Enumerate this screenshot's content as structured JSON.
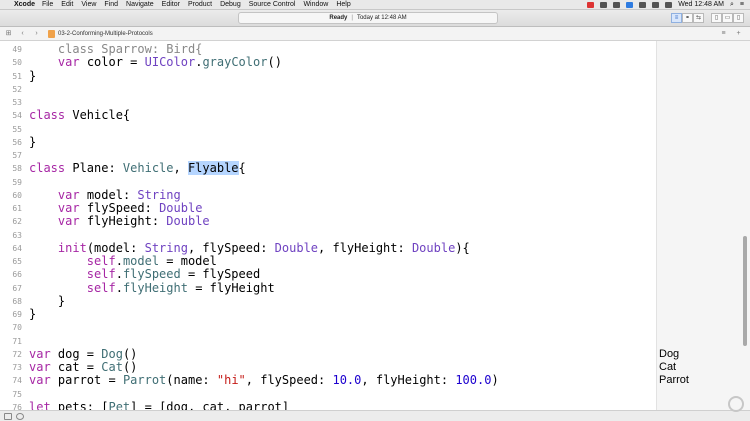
{
  "menubar": {
    "app": "Xcode",
    "items": [
      "File",
      "Edit",
      "View",
      "Find",
      "Navigate",
      "Editor",
      "Product",
      "Debug",
      "Source Control",
      "Window",
      "Help"
    ],
    "clock": "Wed 12:48 AM"
  },
  "toolbar": {
    "status": "Ready",
    "separator": "|",
    "timestamp": "Today at 12:48 AM"
  },
  "jumpbar": {
    "file": "03-2-Conforming-Multiple-Protocols"
  },
  "editor": {
    "lines": [
      {
        "n": "49",
        "t": [
          [
            "    class Sparrow: Bird{",
            "fade"
          ]
        ]
      },
      {
        "n": "50",
        "t": [
          [
            "    ",
            ""
          ],
          [
            "var",
            "kw"
          ],
          [
            " color = ",
            ""
          ],
          [
            "UIColor",
            "ty"
          ],
          [
            ".",
            ""
          ],
          [
            "grayColor",
            "nm"
          ],
          [
            "()",
            ""
          ]
        ]
      },
      {
        "n": "51",
        "t": [
          [
            "}",
            ""
          ]
        ]
      },
      {
        "n": "52",
        "t": []
      },
      {
        "n": "53",
        "t": []
      },
      {
        "n": "54",
        "t": [
          [
            "class",
            "kw"
          ],
          [
            " Vehicle{",
            ""
          ]
        ]
      },
      {
        "n": "55",
        "t": []
      },
      {
        "n": "56",
        "t": [
          [
            "}",
            ""
          ]
        ]
      },
      {
        "n": "57",
        "t": []
      },
      {
        "n": "58",
        "t": [
          [
            "class",
            "kw"
          ],
          [
            " Plane: ",
            ""
          ],
          [
            "Vehicle",
            "nm"
          ],
          [
            ", ",
            ""
          ],
          [
            "Flyable",
            "sel"
          ],
          [
            "{",
            ""
          ]
        ]
      },
      {
        "n": "59",
        "t": []
      },
      {
        "n": "60",
        "t": [
          [
            "    ",
            ""
          ],
          [
            "var",
            "kw"
          ],
          [
            " model: ",
            ""
          ],
          [
            "String",
            "ty"
          ]
        ]
      },
      {
        "n": "61",
        "t": [
          [
            "    ",
            ""
          ],
          [
            "var",
            "kw"
          ],
          [
            " flySpeed: ",
            ""
          ],
          [
            "Double",
            "ty"
          ]
        ]
      },
      {
        "n": "62",
        "t": [
          [
            "    ",
            ""
          ],
          [
            "var",
            "kw"
          ],
          [
            " flyHeight: ",
            ""
          ],
          [
            "Double",
            "ty"
          ]
        ]
      },
      {
        "n": "63",
        "t": []
      },
      {
        "n": "64",
        "t": [
          [
            "    ",
            ""
          ],
          [
            "init",
            "kw"
          ],
          [
            "(model: ",
            ""
          ],
          [
            "String",
            "ty"
          ],
          [
            ", flySpeed: ",
            ""
          ],
          [
            "Double",
            "ty"
          ],
          [
            ", flyHeight: ",
            ""
          ],
          [
            "Double",
            "ty"
          ],
          [
            "){",
            ""
          ]
        ]
      },
      {
        "n": "65",
        "t": [
          [
            "        ",
            ""
          ],
          [
            "self",
            "kw"
          ],
          [
            ".",
            ""
          ],
          [
            "model",
            "nm"
          ],
          [
            " = model",
            ""
          ]
        ]
      },
      {
        "n": "66",
        "t": [
          [
            "        ",
            ""
          ],
          [
            "self",
            "kw"
          ],
          [
            ".",
            ""
          ],
          [
            "flySpeed",
            "nm"
          ],
          [
            " = flySpeed",
            ""
          ]
        ]
      },
      {
        "n": "67",
        "t": [
          [
            "        ",
            ""
          ],
          [
            "self",
            "kw"
          ],
          [
            ".",
            ""
          ],
          [
            "flyHeight",
            "nm"
          ],
          [
            " = flyHeight",
            ""
          ]
        ]
      },
      {
        "n": "68",
        "t": [
          [
            "    }",
            ""
          ]
        ]
      },
      {
        "n": "69",
        "t": [
          [
            "}",
            ""
          ]
        ]
      },
      {
        "n": "70",
        "t": []
      },
      {
        "n": "71",
        "t": []
      },
      {
        "n": "72",
        "t": [
          [
            "var",
            "kw"
          ],
          [
            " dog = ",
            ""
          ],
          [
            "Dog",
            "nm"
          ],
          [
            "()",
            ""
          ]
        ]
      },
      {
        "n": "73",
        "t": [
          [
            "var",
            "kw"
          ],
          [
            " cat = ",
            ""
          ],
          [
            "Cat",
            "nm"
          ],
          [
            "()",
            ""
          ]
        ]
      },
      {
        "n": "74",
        "t": [
          [
            "var",
            "kw"
          ],
          [
            " parrot = ",
            ""
          ],
          [
            "Parrot",
            "nm"
          ],
          [
            "(name: ",
            ""
          ],
          [
            "\"hi\"",
            "str"
          ],
          [
            ", flySpeed: ",
            ""
          ],
          [
            "10.0",
            "num"
          ],
          [
            ", flyHeight: ",
            ""
          ],
          [
            "100.0",
            "num"
          ],
          [
            ")",
            ""
          ]
        ]
      },
      {
        "n": "75",
        "t": []
      },
      {
        "n": "76",
        "t": [
          [
            "let",
            "kw"
          ],
          [
            " pets: [",
            ""
          ],
          [
            "Pet",
            "nm"
          ],
          [
            "] = [dog, cat, parrot]",
            ""
          ]
        ]
      }
    ]
  },
  "results": {
    "items": [
      {
        "line": "72",
        "text": "Dog"
      },
      {
        "line": "73",
        "text": "Cat"
      },
      {
        "line": "74",
        "text": "Parrot"
      }
    ]
  }
}
